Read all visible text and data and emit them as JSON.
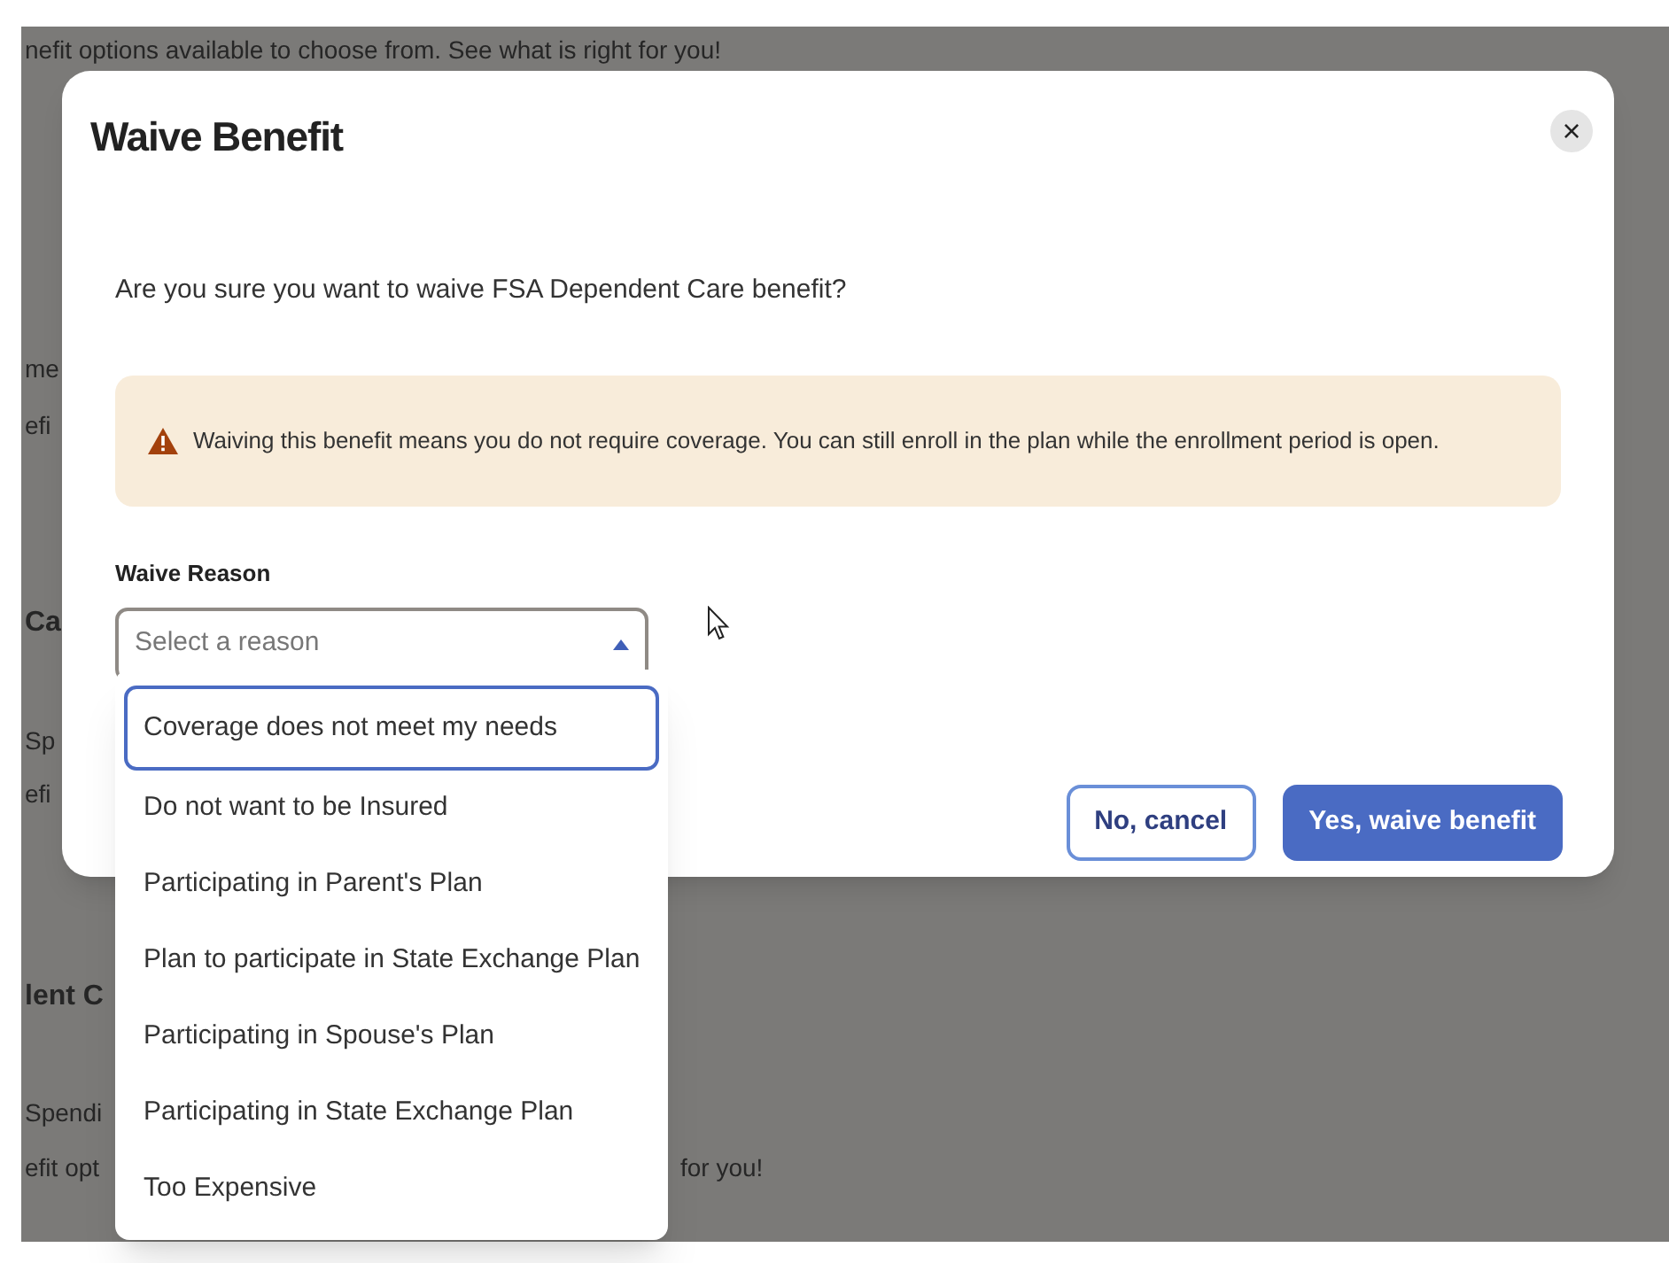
{
  "background": {
    "lines": [
      {
        "kind": "text",
        "left": "nefit options available to choose from. See what is right for you!"
      },
      {
        "kind": "text",
        "left": "me"
      },
      {
        "kind": "text",
        "left": "efi"
      },
      {
        "kind": "heading",
        "left": "Ca"
      },
      {
        "kind": "text",
        "left": "Sp"
      },
      {
        "kind": "text",
        "left": "efi"
      },
      {
        "kind": "heading",
        "left": "lent C"
      },
      {
        "kind": "text",
        "left": "Spendi"
      },
      {
        "kind": "text",
        "left": "efit opt",
        "right": "for you!"
      }
    ]
  },
  "dialog": {
    "title": "Waive Benefit",
    "close": "×",
    "question": "Are you sure you want to waive FSA Dependent Care benefit?",
    "alert": {
      "kind": "warning",
      "text": "Waiving this benefit means you do not require coverage. You can still enroll in the plan while the enrollment period is open."
    },
    "field": {
      "label": "Waive Reason",
      "placeholder": "Select a reason",
      "expanded": true
    },
    "buttons": [
      {
        "kind": "secondary",
        "label": "No, cancel"
      },
      {
        "kind": "primary",
        "label": "Yes, waive benefit"
      }
    ]
  },
  "dropdown": {
    "options": [
      {
        "label": "Coverage does not meet my needs",
        "selected": true
      },
      {
        "label": "Do not want to be Insured",
        "selected": false
      },
      {
        "label": "Participating in Parent's Plan",
        "selected": false
      },
      {
        "label": "Plan to participate in State Exchange Plan",
        "selected": false
      },
      {
        "label": "Participating in Spouse's Plan",
        "selected": false
      },
      {
        "label": "Participating in State Exchange Plan",
        "selected": false
      },
      {
        "label": "Too Expensive",
        "selected": false
      }
    ]
  }
}
